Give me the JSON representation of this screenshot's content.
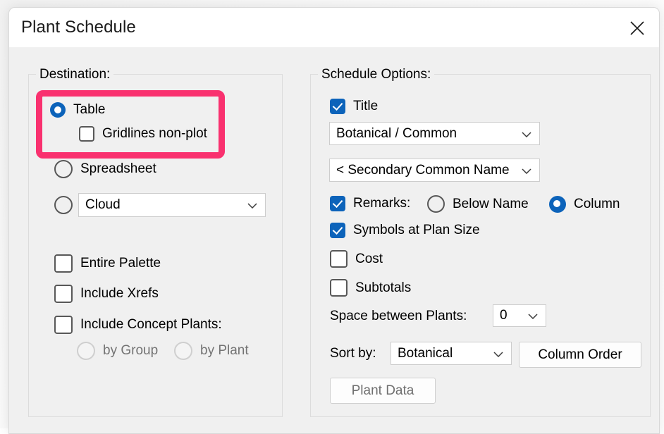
{
  "window": {
    "title": "Plant Schedule",
    "close_icon": "close-icon"
  },
  "destination": {
    "group_label": "Destination:",
    "table_radio": "Table",
    "gridlines_checkbox": "Gridlines non-plot",
    "spreadsheet_radio": "Spreadsheet",
    "cloud_radio": "",
    "cloud_combo_value": "Cloud",
    "entire_palette": "Entire Palette",
    "include_xrefs": "Include Xrefs",
    "include_concept_plants": "Include Concept Plants:",
    "by_group": "by Group",
    "by_plant": "by Plant"
  },
  "schedule": {
    "group_label": "Schedule Options:",
    "title_checkbox": "Title",
    "name_format_combo": "Botanical / Common",
    "secondary_name_combo": "< Secondary Common Name",
    "remarks_checkbox": "Remarks:",
    "remarks_below_name": "Below Name",
    "remarks_column": "Column",
    "symbols_checkbox": "Symbols at Plan Size",
    "cost_checkbox": "Cost",
    "subtotals_checkbox": "Subtotals",
    "space_label": "Space between Plants:",
    "space_value": "0",
    "sort_label": "Sort by:",
    "sort_value": "Botanical",
    "column_order_button": "Column Order",
    "plant_data_button": "Plant Data"
  },
  "colors": {
    "accent_blue": "#0c63ba",
    "highlight_pink": "#f9316f",
    "dialog_bg": "#f0f0f0",
    "titlebar_bg": "#ffffff",
    "disabled_text": "#737373"
  }
}
